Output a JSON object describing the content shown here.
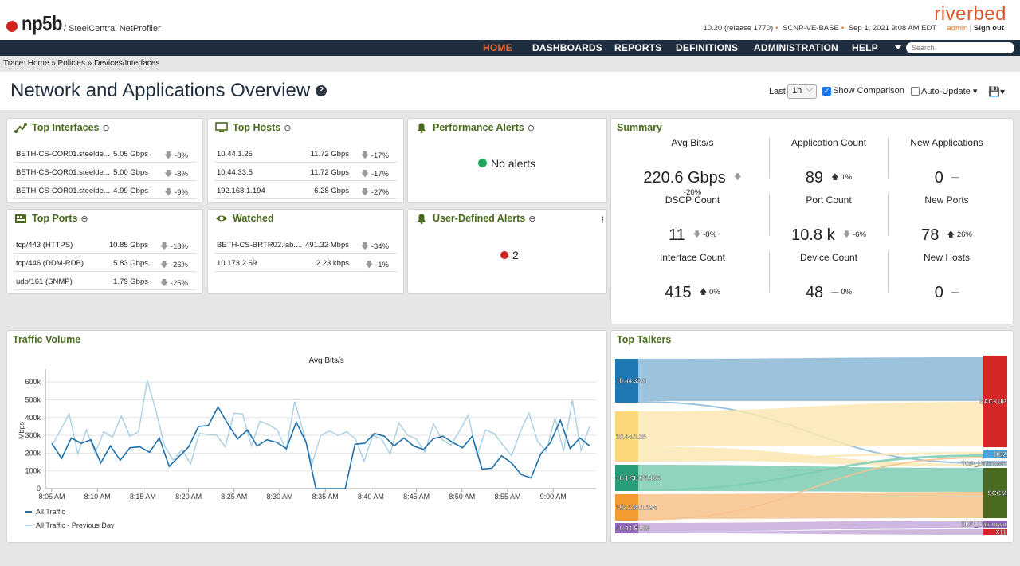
{
  "header": {
    "logo": "np5b",
    "product": "/ SteelCentral NetProfiler",
    "version": "10.20 (release 1770)",
    "system": "SCNP-VE-BASE",
    "datetime": "Sep 1, 2021 9:08 AM EDT",
    "user": "admin",
    "signout": "Sign out",
    "brand": "riverbed"
  },
  "nav": {
    "items": [
      "HOME",
      "DASHBOARDS",
      "REPORTS",
      "DEFINITIONS",
      "ADMINISTRATION",
      "HELP"
    ],
    "search_placeholder": "Search"
  },
  "trace": "Trace: Home » Policies » Devices/Interfaces",
  "page": {
    "title": "Network and Applications Overview",
    "last_label": "Last",
    "last_value": "1h",
    "show_comparison": "Show Comparison",
    "auto_update": "Auto-Update ▾"
  },
  "top_interfaces": {
    "title": "Top Interfaces",
    "rows": [
      {
        "name": "BETH-CS-COR01.steelde...",
        "value": "5.05 Gbps",
        "delta": "-8%"
      },
      {
        "name": "BETH-CS-COR01.steelde...",
        "value": "5.00 Gbps",
        "delta": "-8%"
      },
      {
        "name": "BETH-CS-COR01.steelde...",
        "value": "4.99 Gbps",
        "delta": "-9%"
      }
    ]
  },
  "top_hosts": {
    "title": "Top Hosts",
    "rows": [
      {
        "name": "10.44.1.25",
        "value": "11.72 Gbps",
        "delta": "-17%"
      },
      {
        "name": "10.44.33.5",
        "value": "11.72 Gbps",
        "delta": "-17%"
      },
      {
        "name": "192.168.1.194",
        "value": "6.28 Gbps",
        "delta": "-27%"
      }
    ]
  },
  "performance_alerts": {
    "title": "Performance Alerts",
    "status": "No alerts"
  },
  "top_ports": {
    "title": "Top Ports",
    "rows": [
      {
        "name": "tcp/443 (HTTPS)",
        "value": "10.85 Gbps",
        "delta": "-18%"
      },
      {
        "name": "tcp/446 (DDM-RDB)",
        "value": "5.83 Gbps",
        "delta": "-26%"
      },
      {
        "name": "udp/161 (SNMP)",
        "value": "1.79 Gbps",
        "delta": "-25%"
      }
    ]
  },
  "watched": {
    "title": "Watched",
    "rows": [
      {
        "name": "BETH-CS-BRTR02.lab....",
        "value": "491.32 Mbps",
        "delta": "-34%"
      },
      {
        "name": "10.173.2.69",
        "value": "2.23 kbps",
        "delta": "-1%"
      }
    ]
  },
  "user_alerts": {
    "title": "User-Defined Alerts",
    "count": "2"
  },
  "summary": {
    "title": "Summary",
    "stats": [
      {
        "label": "Avg Bits/s",
        "value": "220.6 Gbps",
        "delta": "-20%",
        "dir": "down"
      },
      {
        "label": "Application Count",
        "value": "89",
        "delta": "1%",
        "dir": "up"
      },
      {
        "label": "New Applications",
        "value": "0",
        "delta": "",
        "dir": "flat"
      },
      {
        "label": "DSCP Count",
        "value": "11",
        "delta": "-8%",
        "dir": "down"
      },
      {
        "label": "Port Count",
        "value": "10.8 k",
        "delta": "-6%",
        "dir": "down"
      },
      {
        "label": "New Ports",
        "value": "78",
        "delta": "26%",
        "dir": "up"
      },
      {
        "label": "Interface Count",
        "value": "415",
        "delta": "0%",
        "dir": "up"
      },
      {
        "label": "Device Count",
        "value": "48",
        "delta": "0%",
        "dir": "flat"
      },
      {
        "label": "New Hosts",
        "value": "0",
        "delta": "",
        "dir": "flat"
      }
    ]
  },
  "traffic_volume": {
    "title": "Traffic Volume"
  },
  "chart_data": {
    "type": "line",
    "title": "Avg Bits/s",
    "ylabel": "Mbps",
    "ylim": [
      0,
      650
    ],
    "yticks": [
      "0",
      "100k",
      "200k",
      "300k",
      "400k",
      "500k",
      "600k"
    ],
    "xticks": [
      "8:05 AM",
      "8:10 AM",
      "8:15 AM",
      "8:20 AM",
      "8:25 AM",
      "8:30 AM",
      "8:35 AM",
      "8:40 AM",
      "8:45 AM",
      "8:50 AM",
      "8:55 AM",
      "9:00 AM"
    ],
    "series": [
      {
        "name": "All Traffic",
        "color": "#1f6fa8",
        "values": [
          255,
          170,
          285,
          255,
          275,
          145,
          240,
          160,
          230,
          235,
          205,
          285,
          125,
          180,
          235,
          350,
          355,
          460,
          365,
          280,
          330,
          240,
          275,
          260,
          225,
          375,
          260,
          0,
          0,
          0,
          0,
          250,
          255,
          310,
          295,
          240,
          285,
          240,
          220,
          280,
          295,
          260,
          230,
          295,
          110,
          115,
          185,
          145,
          80,
          60,
          195,
          260,
          385,
          225,
          285,
          240
        ]
      },
      {
        "name": "All Traffic - Previous Day",
        "color": "#a8cfe4",
        "values": [
          240,
          330,
          420,
          195,
          330,
          200,
          320,
          290,
          410,
          295,
          320,
          610,
          440,
          240,
          160,
          220,
          140,
          310,
          305,
          300,
          235,
          425,
          420,
          240,
          380,
          360,
          330,
          215,
          490,
          320,
          140,
          300,
          325,
          300,
          320,
          280,
          155,
          300,
          280,
          195,
          370,
          300,
          280,
          205,
          365,
          275,
          245,
          325,
          415,
          185,
          330,
          310,
          245,
          185,
          320,
          425,
          265,
          210,
          400,
          210,
          500,
          215,
          350
        ]
      }
    ],
    "grid": true,
    "legend": "bottom-left"
  },
  "top_talkers": {
    "title": "Top Talkers",
    "sources": [
      {
        "label": "10.44.33.5",
        "color": "#1f77b4",
        "flow": "#8ab8d8"
      },
      {
        "label": "10.44.1.25",
        "color": "#fdd87a",
        "flow": "#fbe7b3"
      },
      {
        "label": "10.173.175.105",
        "color": "#2a9d7a",
        "flow": "#7ccbb4"
      },
      {
        "label": "192.168.1.194",
        "color": "#f39a33",
        "flow": "#f7c28c"
      },
      {
        "label": "10.44.51.30",
        "color": "#9467bd",
        "flow": "#c7acd9"
      }
    ],
    "targets": [
      {
        "label": "BACKUP",
        "color": "#d62728"
      },
      {
        "label": "DB2",
        "color": "#4aa3d8"
      },
      {
        "label": "TCP_Unknown",
        "color": "#98c5e0"
      },
      {
        "label": "SCCM",
        "color": "#4a6b1f"
      },
      {
        "label": "UDP_Unknown",
        "color": "#9467bd"
      },
      {
        "label": "X11",
        "color": "#d62728"
      }
    ]
  }
}
